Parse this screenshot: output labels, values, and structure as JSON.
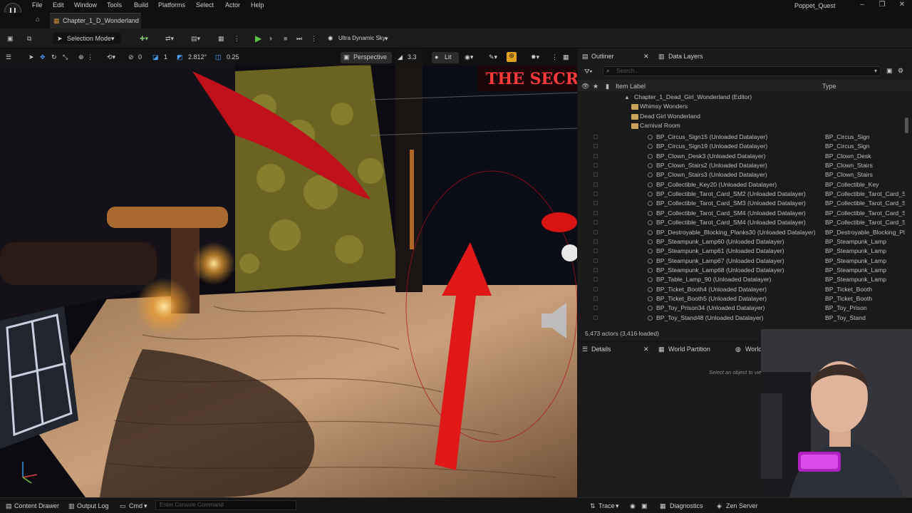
{
  "menu": [
    "File",
    "Edit",
    "Window",
    "Tools",
    "Build",
    "Platforms",
    "Select",
    "Actor",
    "Help"
  ],
  "project_name": "Poppet_Quest",
  "level_tab": "Chapter_1_D_Wonderland",
  "toolbar": {
    "selection_mode": "Selection Mode",
    "sky_label": "Ultra Dynamic Sky"
  },
  "viewport": {
    "grid_snap": "0",
    "rotate_snap": "1",
    "scale_snap": "2.812°",
    "camera_speed_value": "0.25",
    "perspective": "Perspective",
    "fov": "3.3",
    "view_mode": "Lit",
    "scene_text": "THE SECRE"
  },
  "outliner": {
    "tab_label": "Outliner",
    "data_layers_tab": "Data Layers",
    "search_placeholder": "Search...",
    "col_label": "Item Label",
    "col_type": "Type",
    "tree": [
      {
        "label": "Chapter_1_Dead_Girl_Wonderland (Editor)",
        "indent": 0,
        "kind": "world"
      },
      {
        "label": "Whimsy Wonders",
        "indent": 1,
        "kind": "folder"
      },
      {
        "label": "Dead Girl Wonderland",
        "indent": 1,
        "kind": "folder"
      },
      {
        "label": "Carnival Room",
        "indent": 1,
        "kind": "folder"
      }
    ],
    "rows": [
      {
        "label": "BP_Circus_Sign15 (Unloaded Datalayer)",
        "type": "BP_Circus_Sign"
      },
      {
        "label": "BP_Circus_Sign19 (Unloaded Datalayer)",
        "type": "BP_Circus_Sign"
      },
      {
        "label": "BP_Clown_Desk3 (Unloaded Datalayer)",
        "type": "BP_Clown_Desk"
      },
      {
        "label": "BP_Clown_Stairs2 (Unloaded Datalayer)",
        "type": "BP_Clown_Stairs"
      },
      {
        "label": "BP_Clown_Stairs3 (Unloaded Datalayer)",
        "type": "BP_Clown_Stairs"
      },
      {
        "label": "BP_Collectible_Key20 (Unloaded Datalayer)",
        "type": "BP_Collectible_Key"
      },
      {
        "label": "BP_Collectible_Tarot_Card_SM2 (Unloaded Datalayer)",
        "type": "BP_Collectible_Tarot_Card_Sl"
      },
      {
        "label": "BP_Collectible_Tarot_Card_SM3 (Unloaded Datalayer)",
        "type": "BP_Collectible_Tarot_Card_Sl"
      },
      {
        "label": "BP_Collectible_Tarot_Card_SM4 (Unloaded Datalayer)",
        "type": "BP_Collectible_Tarot_Card_Sl"
      },
      {
        "label": "BP_Collectible_Tarot_Card_SM4 (Unloaded Datalayer)",
        "type": "BP_Collectible_Tarot_Card_Sl"
      },
      {
        "label": "BP_Destroyable_Blocking_Planks30 (Unloaded Datalayer)",
        "type": "BP_Destroyable_Blocking_Pla"
      },
      {
        "label": "BP_Steampunk_Lamp60 (Unloaded Datalayer)",
        "type": "BP_Steampunk_Lamp"
      },
      {
        "label": "BP_Steampunk_Lamp61 (Unloaded Datalayer)",
        "type": "BP_Steampunk_Lamp"
      },
      {
        "label": "BP_Steampunk_Lamp67 (Unloaded Datalayer)",
        "type": "BP_Steampunk_Lamp"
      },
      {
        "label": "BP_Steampunk_Lamp68 (Unloaded Datalayer)",
        "type": "BP_Steampunk_Lamp"
      },
      {
        "label": "BP_Table_Lamp_90 (Unloaded Datalayer)",
        "type": "BP_Steampunk_Lamp"
      },
      {
        "label": "BP_Ticket_Booth4 (Unloaded Datalayer)",
        "type": "BP_Ticket_Booth"
      },
      {
        "label": "BP_Ticket_Booth5 (Unloaded Datalayer)",
        "type": "BP_Ticket_Booth"
      },
      {
        "label": "BP_Toy_Prison34 (Unloaded Datalayer)",
        "type": "BP_Toy_Prison"
      },
      {
        "label": "BP_Toy_Stand48 (Unloaded Datalayer)",
        "type": "BP_Toy_Stand"
      }
    ],
    "actor_count": "5,473 actors (3,416 loaded)"
  },
  "details": {
    "tab_details": "Details",
    "tab_world_partition": "World Partition",
    "tab_world_settings": "World Settings",
    "hint": "Select an object to view details."
  },
  "bottom": {
    "content_drawer": "Content Drawer",
    "output_log": "Output Log",
    "cmd": "Cmd",
    "console_placeholder": "Enter Console Command",
    "trace": "Trace",
    "diagnostics": "Diagnostics",
    "zen_server": "Zen Server"
  }
}
